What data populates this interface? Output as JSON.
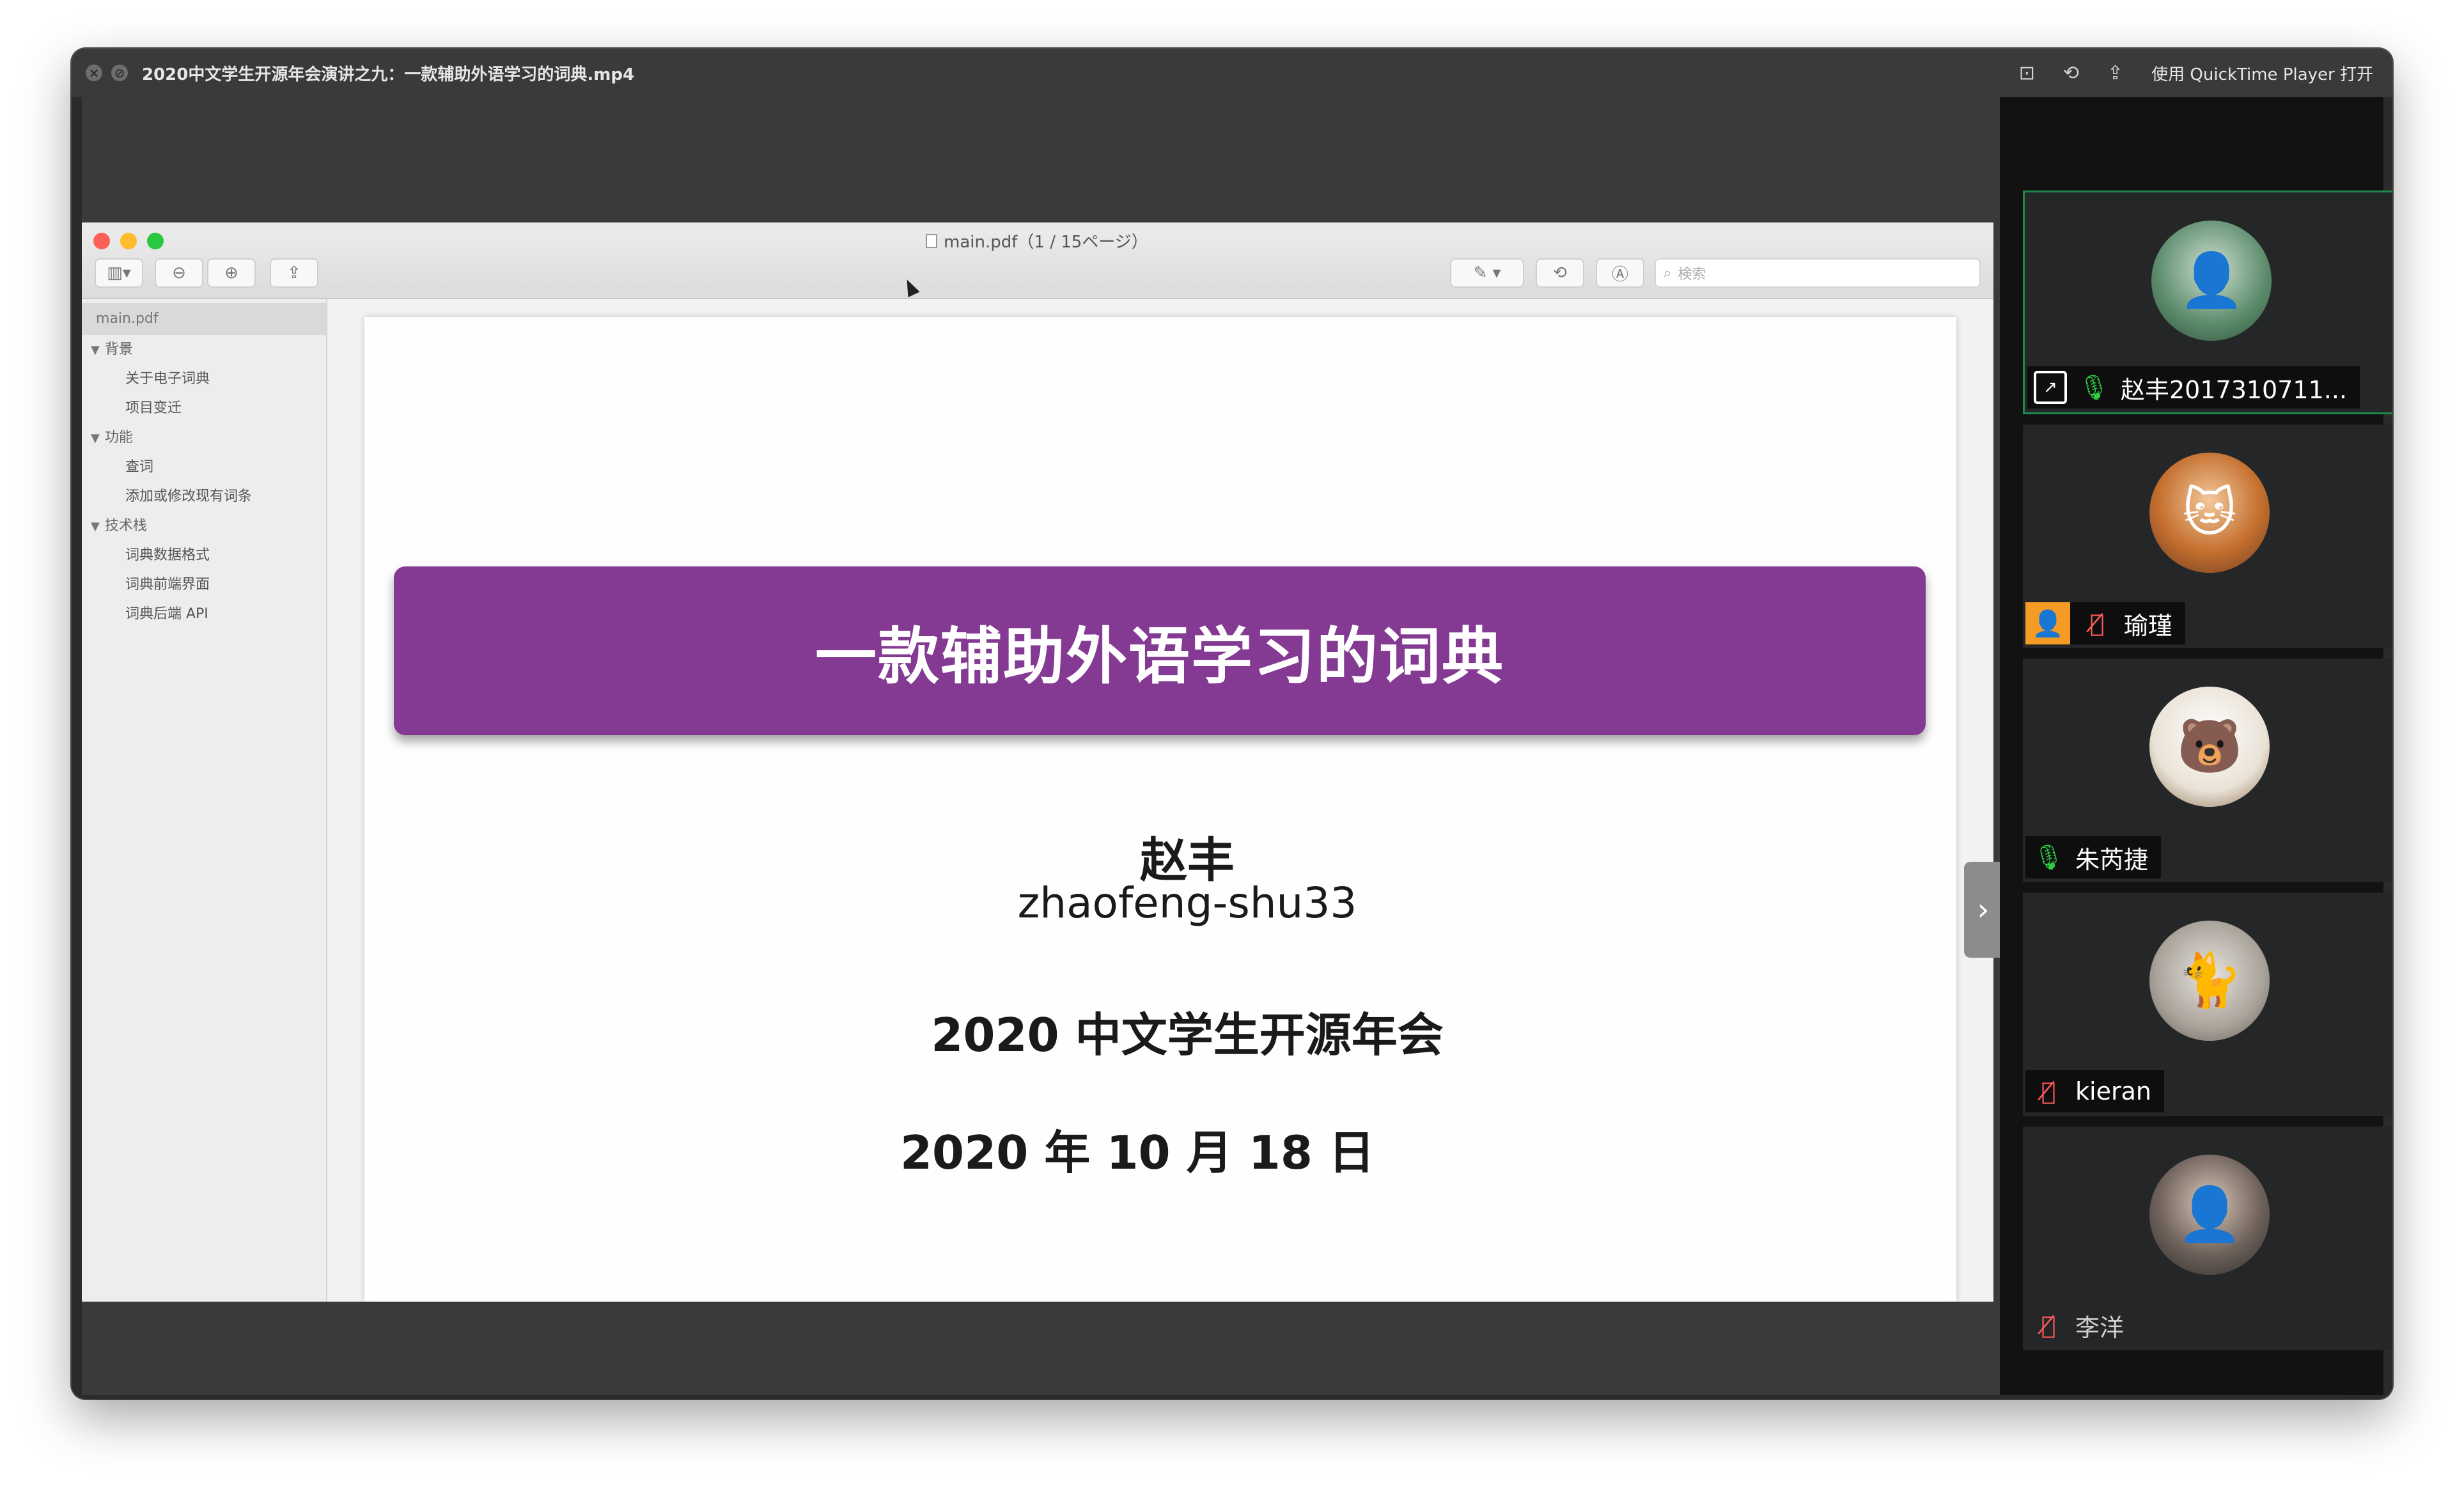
{
  "window": {
    "title": "2020中文学生开源年会演讲之九：一款辅助外语学习的词典.mp4",
    "open_with": "使用 QuickTime Player 打开"
  },
  "preview": {
    "title": "main.pdf（1 / 15ページ）",
    "search_placeholder": "検索",
    "sidebar": {
      "file": "main.pdf",
      "groups": [
        {
          "label": "背景",
          "items": [
            "关于电子词典",
            "项目变迁"
          ]
        },
        {
          "label": "功能",
          "items": [
            "查词",
            "添加或修改现有词条"
          ]
        },
        {
          "label": "技术栈",
          "items": [
            "词典数据格式",
            "词典前端界面",
            "词典后端 API"
          ]
        }
      ]
    },
    "slide": {
      "title": "一款辅助外语学习的词典",
      "author": "赵丰",
      "handle": "zhaofeng-shu33",
      "conference": "2020 中文学生开源年会",
      "date": "2020 年 10 月 18 日"
    },
    "accent_color": "#843a93"
  },
  "participants": [
    {
      "name": "赵丰2017310711...",
      "mic": "on",
      "sharing": true,
      "avatar_icon": "person-photo-avatar"
    },
    {
      "name": "瑜瑾",
      "mic": "off",
      "host": true,
      "avatar_icon": "cat-photo-avatar"
    },
    {
      "name": "朱芮捷",
      "mic": "on",
      "avatar_icon": "bear-avatar"
    },
    {
      "name": "kieran",
      "mic": "off",
      "avatar_icon": "kitten-avatar"
    },
    {
      "name": "李洋",
      "mic": "off",
      "avatar_icon": "person-photo-avatar"
    }
  ]
}
